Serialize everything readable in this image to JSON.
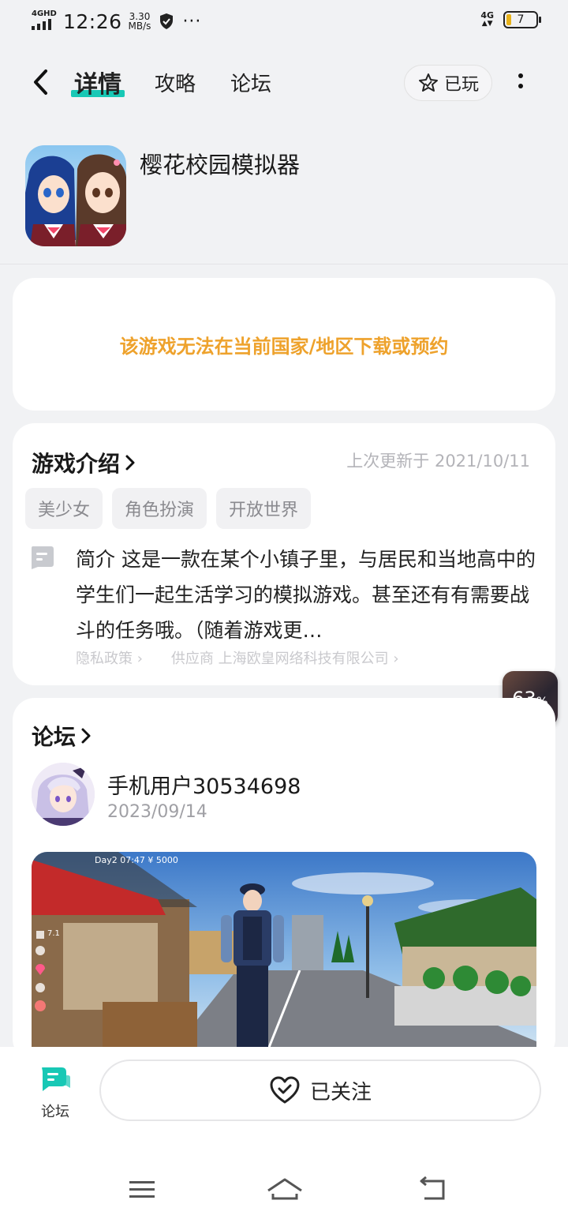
{
  "status_bar": {
    "network": "4GHD",
    "time": "12:26",
    "speed_value": "3.30",
    "speed_unit": "MB/s",
    "dots": "···",
    "network_right": "4G",
    "battery": "7"
  },
  "header": {
    "tabs": [
      {
        "label": "详情",
        "active": true
      },
      {
        "label": "攻略",
        "active": false
      },
      {
        "label": "论坛",
        "active": false
      }
    ],
    "played_label": "已玩",
    "accent_color": "#18c8b5"
  },
  "app": {
    "name": "樱花校园模拟器"
  },
  "notice": {
    "text": "该游戏无法在当前国家/地区下载或预约",
    "color": "#eea22c"
  },
  "intro": {
    "title": "游戏介绍",
    "updated": "上次更新于 2021/10/11",
    "tags": [
      "美少女",
      "角色扮演",
      "开放世界"
    ],
    "text": "简介 这是一款在某个小镇子里，与居民和当地高中的学生们一起生活学习的模拟游戏。甚至还有有需要战斗的任务哦。（随着游戏更…",
    "privacy_link": "隐私政策",
    "supplier_link": "供应商 上海欧皇网络科技有限公司"
  },
  "float_badge": {
    "value": "63",
    "unit": "%"
  },
  "forum": {
    "title": "论坛",
    "post": {
      "user": "手机用户30534698",
      "date": "2023/09/14",
      "image_overlay": "Day2 07:47 ¥ 5000",
      "hud_value": "7.1"
    }
  },
  "bottom": {
    "forum_label": "论坛",
    "follow_label": "已关注"
  }
}
